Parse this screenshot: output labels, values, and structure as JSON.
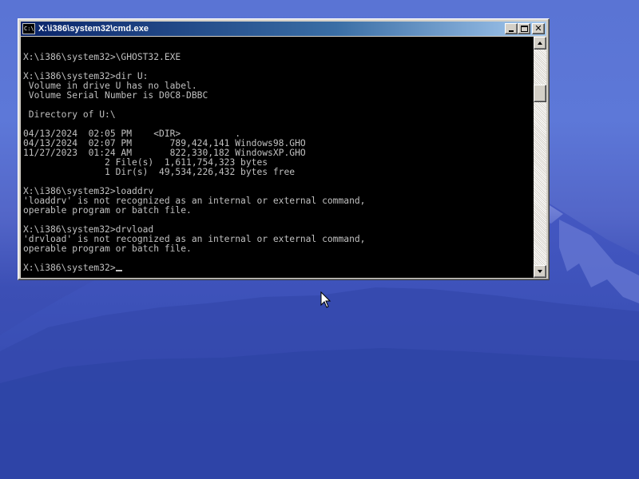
{
  "window": {
    "title": "X:\\i386\\system32\\cmd.exe",
    "icon_label": "C:\\",
    "controls": {
      "minimize": "minimize-icon",
      "maximize": "maximize-icon",
      "close": "close-icon",
      "close_glyph": "✕"
    }
  },
  "console": {
    "text_color": "#c0c0c0",
    "background": "#000000",
    "lines": [
      "",
      "X:\\i386\\system32>\\GHOST32.EXE",
      "",
      "X:\\i386\\system32>dir U:",
      " Volume in drive U has no label.",
      " Volume Serial Number is D0C8-DBBC",
      "",
      " Directory of U:\\",
      "",
      "04/13/2024  02:05 PM    <DIR>          .",
      "04/13/2024  02:07 PM       789,424,141 Windows98.GHO",
      "11/27/2023  01:24 AM       822,330,182 WindowsXP.GHO",
      "               2 File(s)  1,611,754,323 bytes",
      "               1 Dir(s)  49,534,226,432 bytes free",
      "",
      "X:\\i386\\system32>loaddrv",
      "'loaddrv' is not recognized as an internal or external command,",
      "operable program or batch file.",
      "",
      "X:\\i386\\system32>drvload",
      "'drvload' is not recognized as an internal or external command,",
      "operable program or batch file.",
      "",
      "X:\\i386\\system32>"
    ]
  },
  "scrollbar": {
    "up_icon": "scroll-up-arrow-icon",
    "down_icon": "scroll-down-arrow-icon"
  },
  "desktop": {
    "wallpaper": "mountain-at-dusk",
    "sky_color": "#5a74d4",
    "mountain_color": "#3a4fb0"
  },
  "pointer": {
    "icon": "mouse-pointer-icon"
  }
}
